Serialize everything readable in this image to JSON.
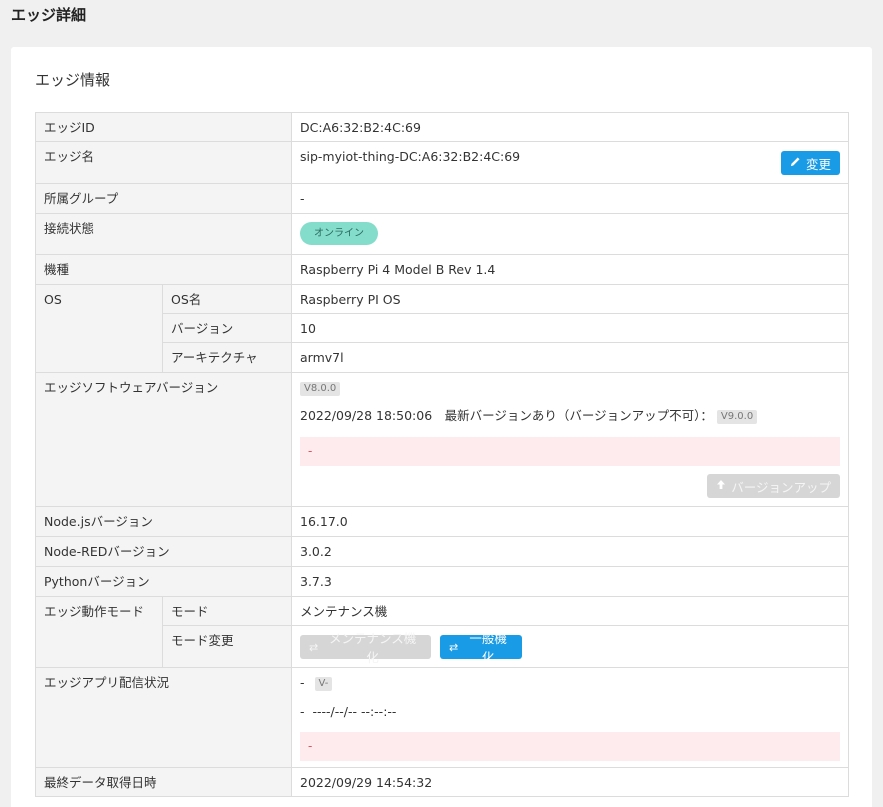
{
  "page": {
    "title": "エッジ詳細"
  },
  "card": {
    "title": "エッジ情報"
  },
  "rows": {
    "edge_id": {
      "label": "エッジID",
      "value": "DC:A6:32:B2:4C:69"
    },
    "edge_name": {
      "label": "エッジ名",
      "value": "sip-myiot-thing-DC:A6:32:B2:4C:69",
      "button": "変更"
    },
    "group": {
      "label": "所属グループ",
      "value": "-"
    },
    "connection": {
      "label": "接続状態",
      "status": "オンライン"
    },
    "model": {
      "label": "機種",
      "value": "Raspberry Pi 4 Model B Rev 1.4"
    },
    "os": {
      "label": "OS",
      "name_label": "OS名",
      "name_value": "Raspberry PI OS",
      "version_label": "バージョン",
      "version_value": "10",
      "arch_label": "アーキテクチャ",
      "arch_value": "armv7l"
    },
    "software": {
      "label": "エッジソフトウェアバージョン",
      "current_tag": "V8.0.0",
      "timestamp_line": "2022/09/28 18:50:06　最新バージョンあり（バージョンアップ不可）：",
      "latest_tag": "V9.0.0",
      "alert": "-",
      "button": "バージョンアップ"
    },
    "nodejs": {
      "label": "Node.jsバージョン",
      "value": "16.17.0"
    },
    "nodered": {
      "label": "Node-REDバージョン",
      "value": "3.0.2"
    },
    "python": {
      "label": "Pythonバージョン",
      "value": "3.7.3"
    },
    "mode": {
      "label": "エッジ動作モード",
      "mode_label": "モード",
      "mode_value": "メンテナンス機",
      "change_label": "モード変更",
      "maintenance_button": "メンテナンス機化",
      "general_button": "一般機化"
    },
    "app": {
      "label": "エッジアプリ配信状況",
      "dash": "-",
      "version_tag": "V-",
      "date_line": "-  ----/--/-- --:--:--",
      "alert": "-"
    },
    "last_data": {
      "label": "最終データ取得日時",
      "value": "2022/09/29 14:54:32"
    }
  },
  "icons": {
    "edit": "pencil-icon",
    "upload": "arrow-up-icon",
    "switch": "swap-icon"
  }
}
